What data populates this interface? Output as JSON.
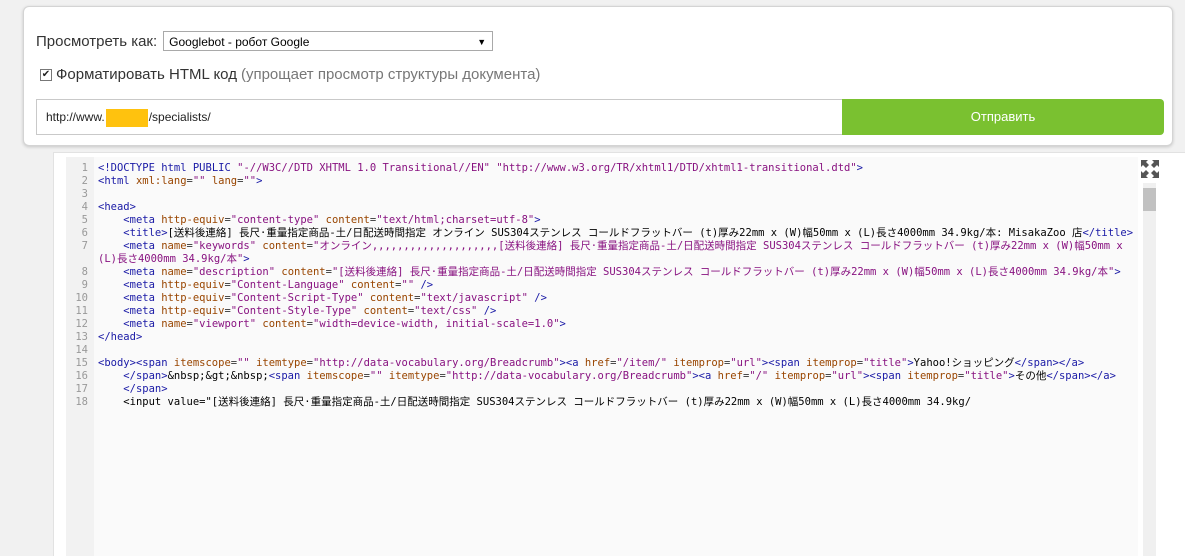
{
  "form": {
    "view_as_label": "Просмотреть как:",
    "view_as_value": "Googlebot - робот Google",
    "format_checked": true,
    "format_label": "Форматировать HTML код",
    "format_hint": "(упрощает просмотр структуры документа)",
    "url_prefix": "http://www.",
    "url_suffix": "/specialists/",
    "submit_label": "Отправить"
  },
  "icons": {
    "dropdown": "triangle-down-icon",
    "checkbox": "checkbox-checked-icon",
    "fullscreen": "fullscreen-expand-icon"
  },
  "colors": {
    "submit_bg": "#7ac130",
    "url_mask": "#ffc20e"
  },
  "code_lines": [
    {
      "n": "1",
      "t": "<!DOCTYPE html PUBLIC \"-//W3C//DTD XHTML 1.0 Transitional//EN\" \"http://www.w3.org/TR/xhtml1/DTD/xhtml1-transitional.dtd\">"
    },
    {
      "n": "2",
      "t": "<html xml:lang=\"\" lang=\"\">"
    },
    {
      "n": "3",
      "t": ""
    },
    {
      "n": "4",
      "t": "<head>"
    },
    {
      "n": "5",
      "t": "    <meta http-equiv=\"content-type\" content=\"text/html;charset=utf-8\">"
    },
    {
      "n": "6",
      "t": "    <title>[送料後連絡] 長尺·重量指定商品-土/日配送時間指定 オンライン SUS304ステンレス コールドフラットバー (t)厚み22mm x (W)幅50mm x (L)長さ4000mm 34.9kg/本: MisakaZoo 店</title>"
    },
    {
      "n": "7",
      "t": "    <meta name=\"keywords\" content=\"オンライン,,,,,,,,,,,,,,,,,,,,[送料後連絡] 長尺·重量指定商品-土/日配送時間指定 SUS304ステンレス コールドフラットバー (t)厚み22mm x (W)幅50mm x (L)長さ4000mm 34.9kg/本\">"
    },
    {
      "n": "8",
      "t": "    <meta name=\"description\" content=\"[送料後連絡] 長尺·重量指定商品-土/日配送時間指定 SUS304ステンレス コールドフラットバー (t)厚み22mm x (W)幅50mm x (L)長さ4000mm 34.9kg/本\">"
    },
    {
      "n": "9",
      "t": "    <meta http-equiv=\"Content-Language\" content=\"\" />"
    },
    {
      "n": "10",
      "t": "    <meta http-equiv=\"Content-Script-Type\" content=\"text/javascript\" />"
    },
    {
      "n": "11",
      "t": "    <meta http-equiv=\"Content-Style-Type\" content=\"text/css\" />"
    },
    {
      "n": "12",
      "t": "    <meta name=\"viewport\" content=\"width=device-width, initial-scale=1.0\">"
    },
    {
      "n": "13",
      "t": "</head>"
    },
    {
      "n": "14",
      "t": ""
    },
    {
      "n": "15",
      "t": "<body><span itemscope=\"\" itemtype=\"http://data-vocabulary.org/Breadcrumb\"><a href=\"/item/\" itemprop=\"url\"><span itemprop=\"title\">Yahoo!ショッピング</span></a>"
    },
    {
      "n": "16",
      "t": "    </span>&nbsp;&gt;&nbsp;<span itemscope=\"\" itemtype=\"http://data-vocabulary.org/Breadcrumb\"><a href=\"/\" itemprop=\"url\"><span itemprop=\"title\">その他</span></a>"
    },
    {
      "n": "17",
      "t": "    </span>"
    },
    {
      "n": "18",
      "t": "    <input value=\"[送料後連絡] 長尺·重量指定商品-土/日配送時間指定 SUS304ステンレス コールドフラットバー (t)厚み22mm x (W)幅50mm x (L)長さ4000mm 34.9kg/"
    }
  ]
}
